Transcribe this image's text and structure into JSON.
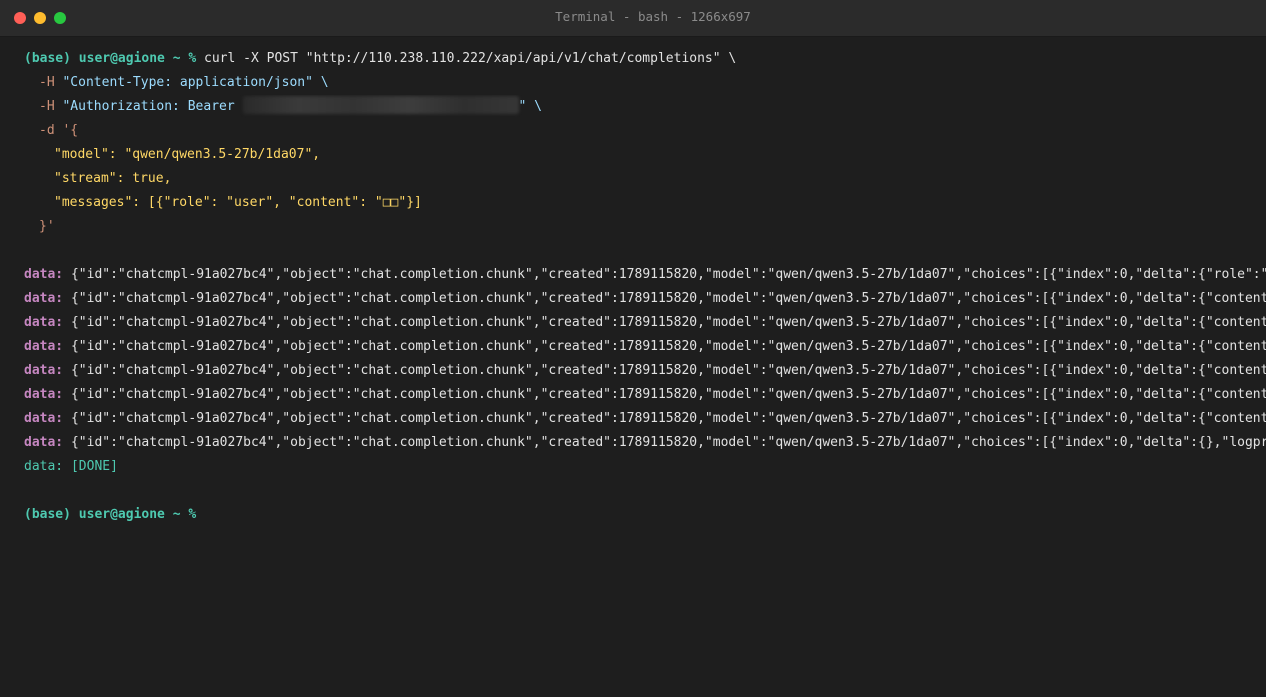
{
  "window": {
    "title": "Terminal - bash - 1266x697"
  },
  "colors": {
    "close": "#ff5f57",
    "minimize": "#febc2e",
    "maximize": "#28c840",
    "background": "#1e1e1e"
  },
  "terminal": {
    "command": {
      "prompt": "(base) user@agione ~ %",
      "line1": " curl -X POST \"http://110.238.110.222/xapi/api/v1/chat/completions\" \\",
      "line2_opt": "-H",
      "line2_str": " \"Content-Type: application/json\" \\",
      "line3_opt": "-H",
      "line3_str_a": " \"Authorization: Bearer ",
      "line3_str_b": "\" \\",
      "line4_opt": "-d",
      "line4_str": " '{",
      "body_model": "\"model\": \"qwen/qwen3.5-27b/1da07\",",
      "body_stream": "\"stream\": true,",
      "body_messages": "\"messages\": [{\"role\": \"user\", \"content\": \"□□\"}]",
      "close": "}'"
    },
    "data_label": "data:",
    "data_lines": [
      " {\"id\":\"chatcmpl-91a027bc4\",\"object\":\"chat.completion.chunk\",\"created\":1789115820,\"model\":\"qwen/qwen3.5-27b/1da07\",\"choices\":[{\"index\":0,\"delta\":{\"role\":\"assistant\"",
      " {\"id\":\"chatcmpl-91a027bc4\",\"object\":\"chat.completion.chunk\",\"created\":1789115820,\"model\":\"qwen/qwen3.5-27b/1da07\",\"choices\":[{\"index\":0,\"delta\":{\"content\":",
      " {\"id\":\"chatcmpl-91a027bc4\",\"object\":\"chat.completion.chunk\",\"created\":1789115820,\"model\":\"qwen/qwen3.5-27b/1da07\",\"choices\":[{\"index\":0,\"delta\":{\"content\":",
      " {\"id\":\"chatcmpl-91a027bc4\",\"object\":\"chat.completion.chunk\",\"created\":1789115820,\"model\":\"qwen/qwen3.5-27b/1da07\",\"choices\":[{\"index\":0,\"delta\":{\"content\":",
      " {\"id\":\"chatcmpl-91a027bc4\",\"object\":\"chat.completion.chunk\",\"created\":1789115820,\"model\":\"qwen/qwen3.5-27b/1da07\",\"choices\":[{\"index\":0,\"delta\":{\"content\":",
      " {\"id\":\"chatcmpl-91a027bc4\",\"object\":\"chat.completion.chunk\",\"created\":1789115820,\"model\":\"qwen/qwen3.5-27b/1da07\",\"choices\":[{\"index\":0,\"delta\":{\"content\":",
      " {\"id\":\"chatcmpl-91a027bc4\",\"object\":\"chat.completion.chunk\",\"created\":1789115820,\"model\":\"qwen/qwen3.5-27b/1da07\",\"choices\":[{\"index\":0,\"delta\":{\"content\":",
      " {\"id\":\"chatcmpl-91a027bc4\",\"object\":\"chat.completion.chunk\",\"created\":1789115820,\"model\":\"qwen/qwen3.5-27b/1da07\",\"choices\":[{\"index\":0,\"delta\":{},\"logprobs\""
    ],
    "done_line": "data: [DONE]",
    "final_prompt": "(base) user@agione ~ %"
  }
}
